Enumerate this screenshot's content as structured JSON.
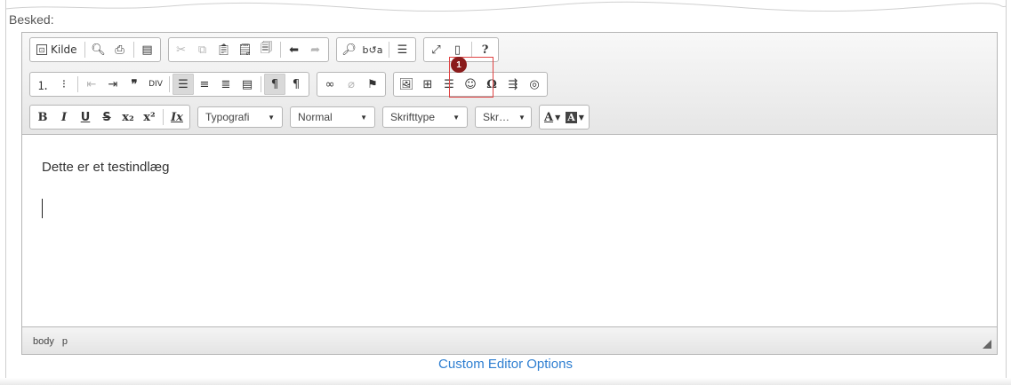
{
  "form": {
    "field_label": "Besked:",
    "footer_link": "Custom Editor Options"
  },
  "toolbar": {
    "row1": {
      "source_label": "Kilde",
      "source_icon": "source-icon",
      "help_label": "?"
    },
    "row3": {
      "format_combo": "Typografi",
      "style_combo": "Normal",
      "font_combo": "Skrifttype",
      "size_combo": "Skr…",
      "bold": "B",
      "italic": "I",
      "underline": "U",
      "strike": "S",
      "subscript": "x₂",
      "superscript": "x²",
      "remove_format": "Ix",
      "text_color": "A",
      "bg_color": "A"
    }
  },
  "content": {
    "paragraph": "Dette er et testindlæg"
  },
  "status": {
    "path": [
      "body",
      "p"
    ]
  },
  "annotation": {
    "badge_number": "1",
    "highlight_color": "#e04343",
    "badge_color": "#8a1c1c"
  },
  "colors": {
    "link": "#2f7fd1",
    "toolbar_bg": "#e6e6e6"
  }
}
